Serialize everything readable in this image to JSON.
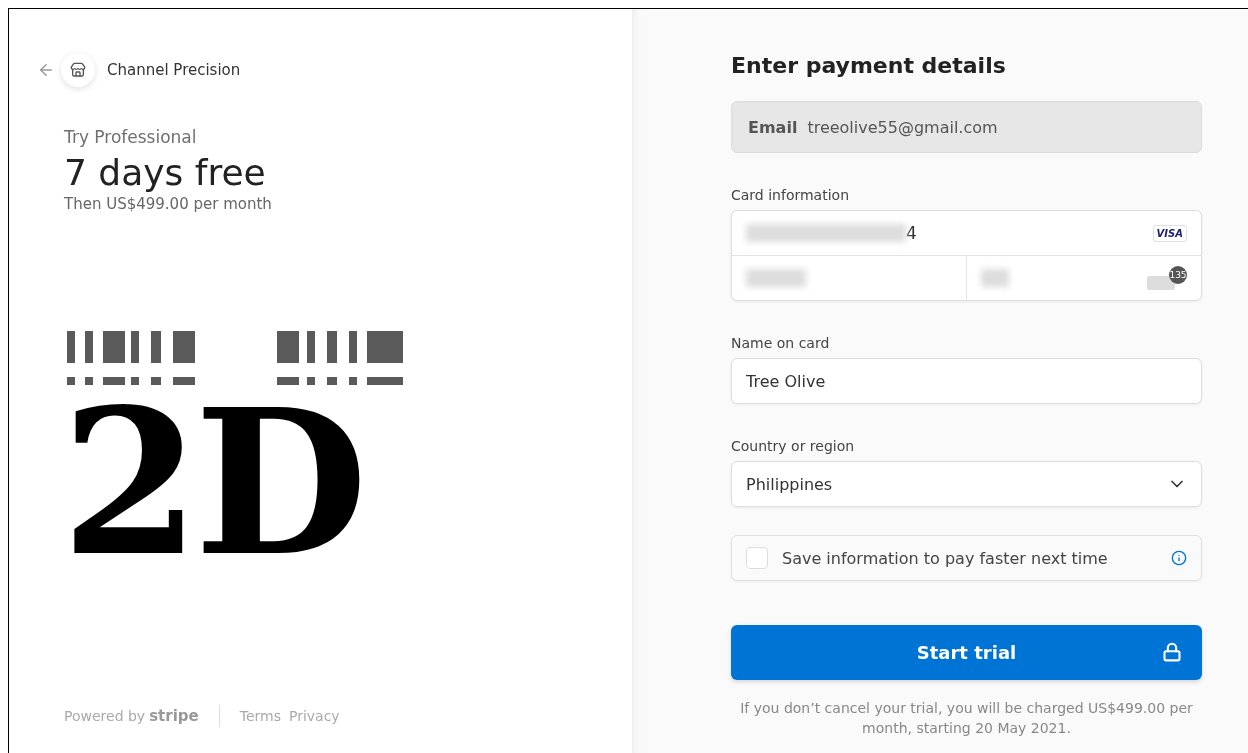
{
  "merchant": {
    "name": "Channel Precision"
  },
  "offer": {
    "eyebrow": "Try Professional",
    "headline": "7 days free",
    "subline": "Then US$499.00 per month"
  },
  "logo": {
    "kind": "picture",
    "text": "2D"
  },
  "footer": {
    "powered_by": "Powered by",
    "brand": "stripe",
    "links": [
      "Terms",
      "Privacy"
    ]
  },
  "form": {
    "title": "Enter payment details",
    "email": {
      "label": "Email",
      "value": "treeolive55@gmail.com"
    },
    "card": {
      "label": "Card information",
      "number": {
        "value": "4",
        "redacted": true
      },
      "brand": "VISA",
      "expiry": {
        "redacted": true
      },
      "cvc": {
        "redacted": true,
        "badge": "135"
      }
    },
    "name": {
      "label": "Name on card",
      "value": "Tree Olive"
    },
    "country": {
      "label": "Country or region",
      "value": "Philippines"
    },
    "save": {
      "label": "Save information to pay faster next time",
      "checked": false
    },
    "submit": {
      "label": "Start trial"
    },
    "note": "If you don’t cancel your trial, you will be charged US$499.00 per month, starting 20 May 2021."
  }
}
